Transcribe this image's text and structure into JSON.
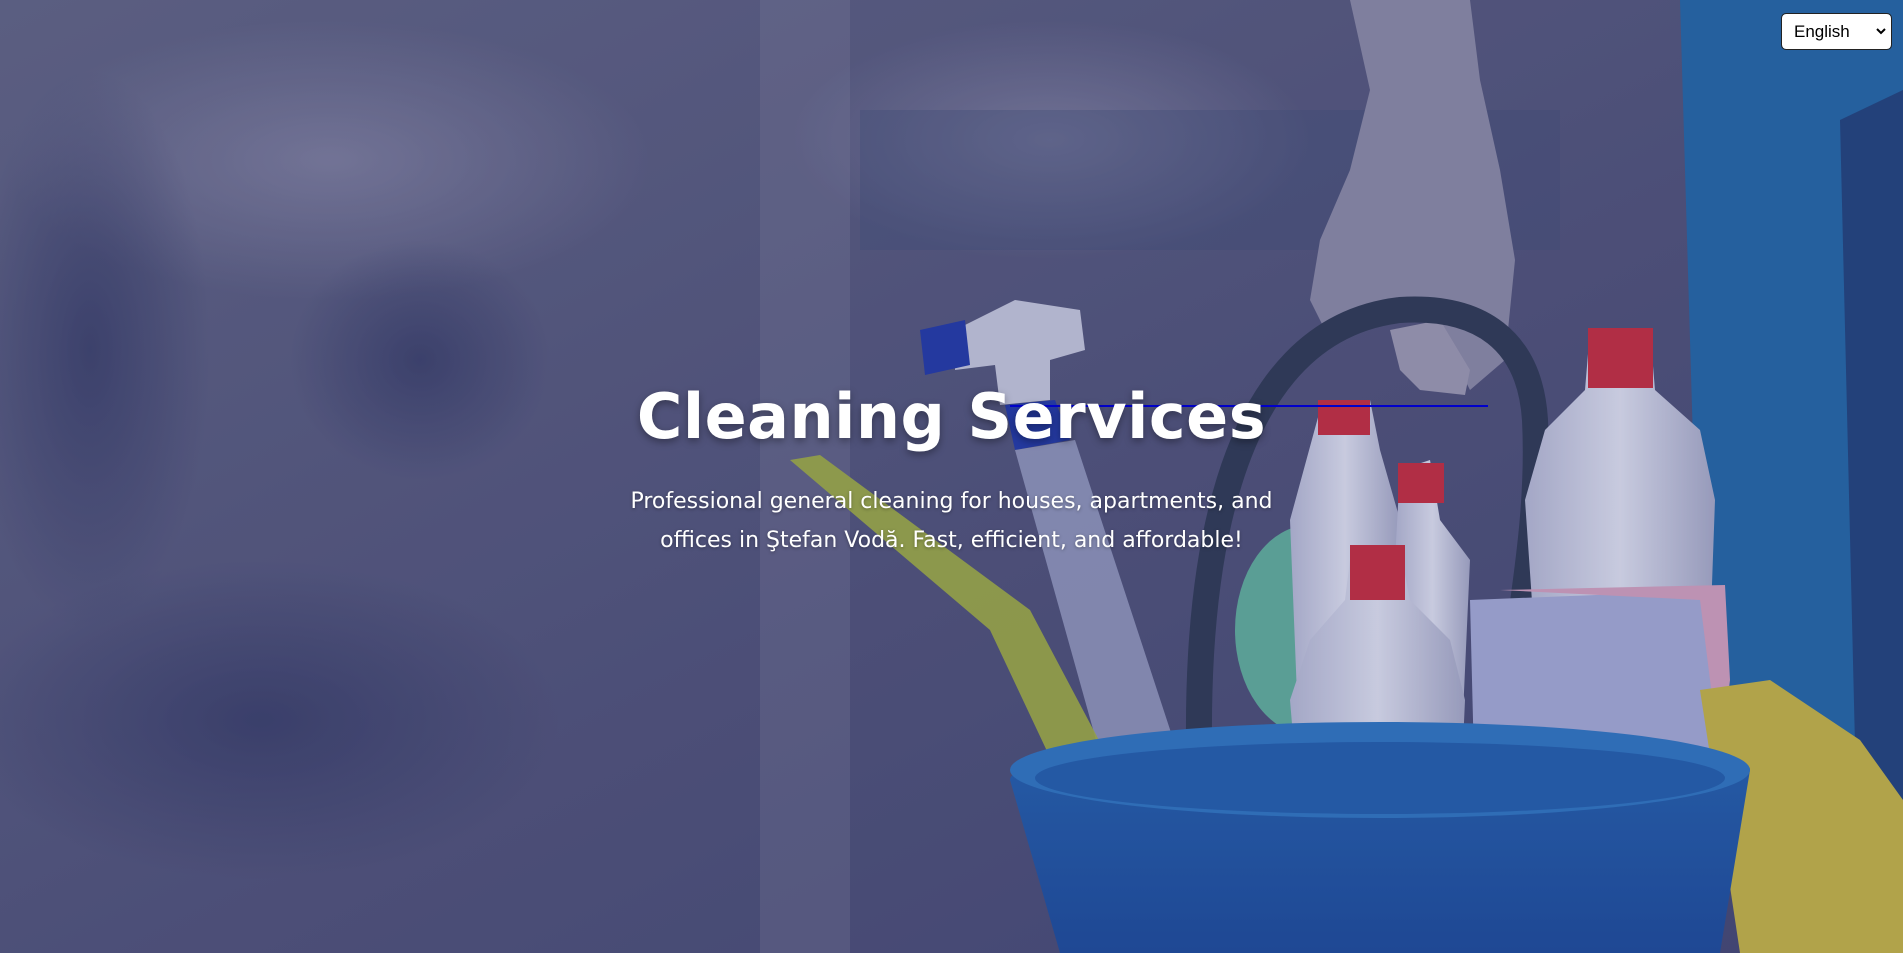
{
  "language_select": {
    "selected": "English",
    "options": [
      "English"
    ]
  },
  "hero": {
    "title": "Cleaning Services",
    "subtitle": "Professional general cleaning for houses, apartments, and offices in Ştefan Vodă. Fast, efficient, and affordable!",
    "background_image": "cleaning-supplies-bucket-photo"
  },
  "colors": {
    "overlay": "#4f5079",
    "accent_line": "#0000cc",
    "text": "#ffffff"
  }
}
